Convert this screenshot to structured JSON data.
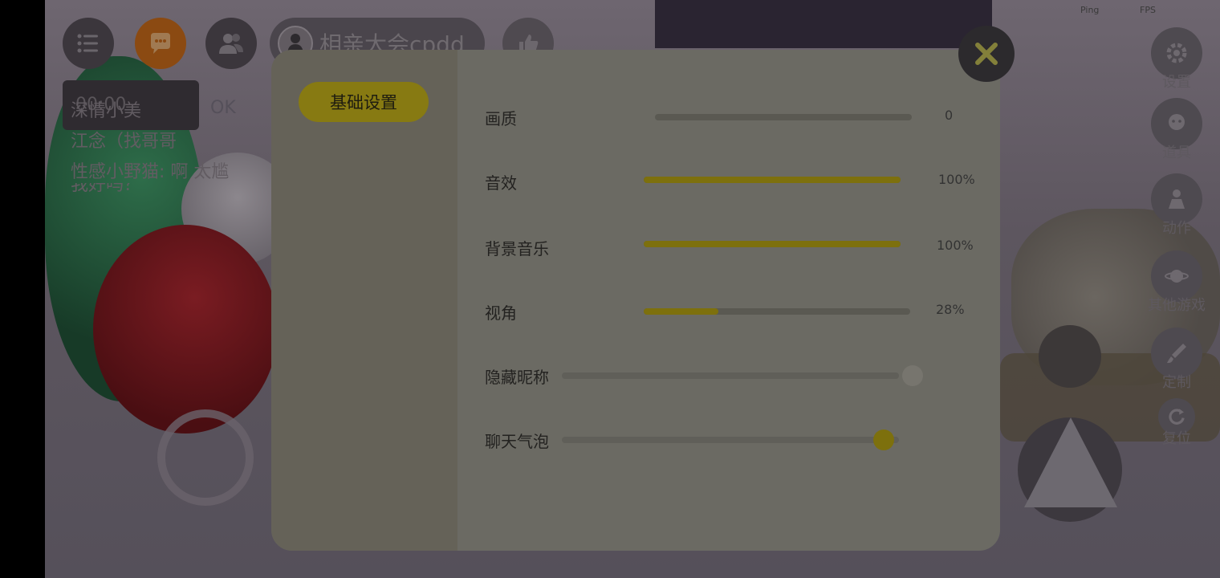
{
  "hud": {
    "room_name": "相亲大会cpdd"
  },
  "chat": {
    "voice_timer": "00:00",
    "ok_label": "OK",
    "messages": [
      "深情小美",
      "江念（找哥哥",
      "性感小野猫: 啊    太尴",
      "我好吗？"
    ]
  },
  "status": {
    "ping": "Ping",
    "fps": "FPS"
  },
  "side_menu": {
    "settings": "设置",
    "props": "道具",
    "actions": "动作",
    "other_games": "其他游戏",
    "custom": "定制",
    "reset": "复位"
  },
  "panel": {
    "tab_basic": "基础设置",
    "settings": {
      "quality": {
        "label": "画质",
        "value": "0",
        "level": 0
      },
      "sfx": {
        "label": "音效",
        "value": "100%",
        "level": 1.0
      },
      "bgm": {
        "label": "背景音乐",
        "value": "100%",
        "level": 1.0
      },
      "view_angle": {
        "label": "视角",
        "value": "28%",
        "level": 0.28
      },
      "hide_nickname": {
        "label": "隐藏昵称",
        "enabled": false
      },
      "chat_bubble": {
        "label": "聊天气泡",
        "enabled": true
      }
    }
  },
  "colors": {
    "accent": "#877a12",
    "panel": "#6b6a63"
  }
}
